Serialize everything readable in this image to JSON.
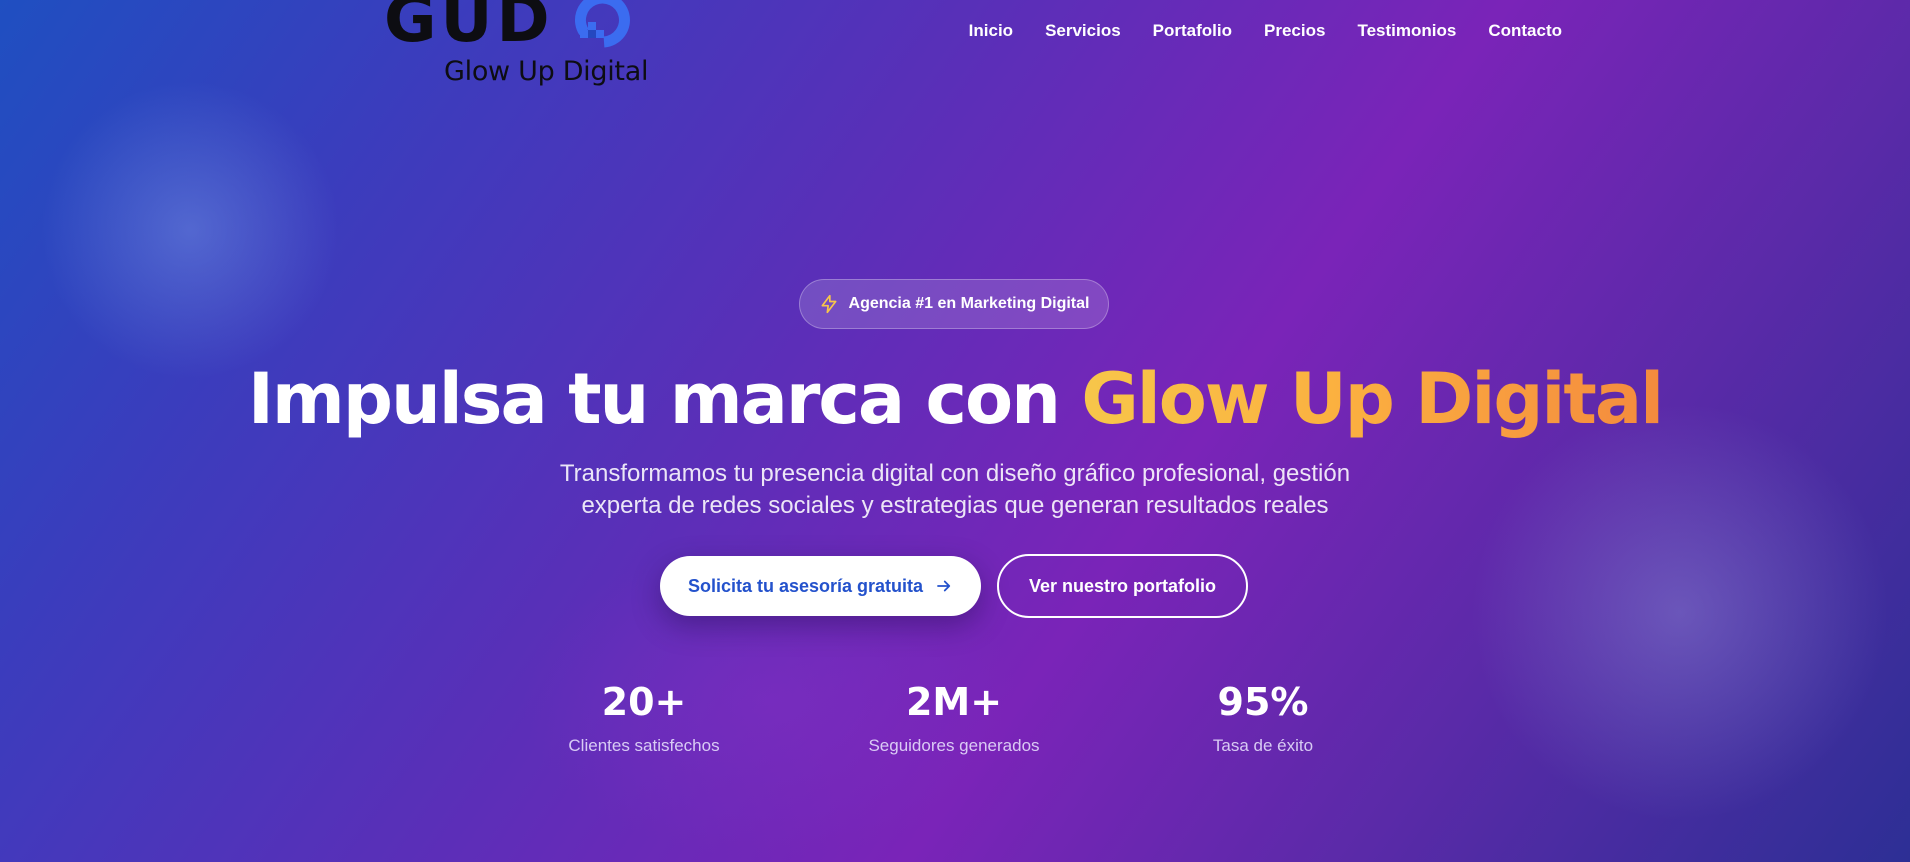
{
  "brand": {
    "logo_text": "GUD",
    "tagline": "Glow Up Digital"
  },
  "nav": {
    "items": [
      {
        "label": "Inicio"
      },
      {
        "label": "Servicios"
      },
      {
        "label": "Portafolio"
      },
      {
        "label": "Precios"
      },
      {
        "label": "Testimonios"
      },
      {
        "label": "Contacto"
      }
    ]
  },
  "hero": {
    "badge": {
      "icon": "lightning-icon",
      "text": "Agencia #1 en Marketing Digital"
    },
    "headline_main": "Impulsa tu marca con",
    "headline_accent": "Glow Up Digital",
    "subtitle_line1": "Transformamos tu presencia digital con diseño gráfico profesional, gestión",
    "subtitle_line2": "experta de redes sociales y estrategias que generan resultados reales",
    "primary_cta": {
      "label": "Solicita tu asesoría gratuita",
      "icon": "arrow-right-icon"
    },
    "secondary_cta": {
      "label": "Ver nuestro portafolio"
    }
  },
  "stats": [
    {
      "value": "20+",
      "label": "Clientes satisfechos"
    },
    {
      "value": "2M+",
      "label": "Seguidores generados"
    },
    {
      "value": "95%",
      "label": "Tasa de éxito"
    }
  ],
  "colors": {
    "accent_gradient_start": "#f7c64a",
    "accent_gradient_end": "#f48a3e",
    "primary_button_text": "#2452cc",
    "logo_mark_blue": "#3b6cf0"
  }
}
